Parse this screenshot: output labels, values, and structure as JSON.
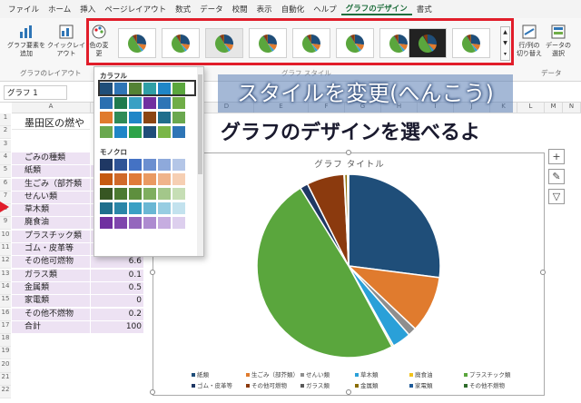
{
  "menu": [
    "ファイル",
    "ホーム",
    "挿入",
    "ページレイアウト",
    "数式",
    "データ",
    "校閲",
    "表示",
    "自動化",
    "ヘルプ",
    "グラフのデザイン",
    "書式"
  ],
  "ribbon": {
    "add_element": "グラフ要素を追加",
    "quick_layout": "クイックレイアウト",
    "change_colors": "色の変更",
    "layout_group": "グラフのレイアウト",
    "styles_group": "グラフ スタイル",
    "switch_rowcol": "行/列の切り替え",
    "select_data": "データの選択",
    "data_group": "データ"
  },
  "palette": {
    "colorful": "カラフル",
    "mono": "モノクロ",
    "colorful_rows": [
      [
        "#1f4e79",
        "#2e75b6",
        "#548235",
        "#2f9fa6",
        "#1f86c7",
        "#5aa63d"
      ],
      [
        "#2b6fb0",
        "#1f7a4e",
        "#39a0c4",
        "#7030a0",
        "#2e75b6",
        "#70ad47"
      ],
      [
        "#e07b2e",
        "#2e8b57",
        "#1f86c7",
        "#8b4513",
        "#1f6e8c",
        "#6aa84f"
      ],
      [
        "#6aa84f",
        "#1f86c7",
        "#2ea34a",
        "#1f4e79",
        "#7ab648",
        "#2e75b6"
      ]
    ],
    "mono_rows": [
      [
        "#1f3864",
        "#2f5496",
        "#4472c4",
        "#6b8fd0",
        "#8ea9db",
        "#b4c6e7"
      ],
      [
        "#c55a11",
        "#d06a2a",
        "#e07b39",
        "#ea9a62",
        "#f0b48b",
        "#f6cfb3"
      ],
      [
        "#375623",
        "#4c7a31",
        "#5e8f3e",
        "#7fae5f",
        "#a3c78a",
        "#c6deb5"
      ],
      [
        "#1f6e8c",
        "#2a86a8",
        "#3aa0c4",
        "#6ab7d4",
        "#97cde2",
        "#c3e2ee"
      ],
      [
        "#7030a0",
        "#7f46ad",
        "#9467bd",
        "#ad8bd0",
        "#c6ade0",
        "#ddcfee"
      ]
    ]
  },
  "formula": {
    "namebox": "グラフ 1"
  },
  "columns": [
    "A",
    "B",
    "C",
    "D",
    "E",
    "F",
    "G",
    "H",
    "I",
    "J",
    "K",
    "L",
    "M",
    "N"
  ],
  "sheet": {
    "title": "墨田区の燃や",
    "header": "ごみの種類",
    "rows": [
      [
        "紙類",
        ""
      ],
      [
        "生ごみ（部芥類",
        ""
      ],
      [
        "せんい類",
        ""
      ],
      [
        "草木類",
        ""
      ],
      [
        "廃食油",
        ""
      ],
      [
        "プラスチック類",
        ""
      ],
      [
        "ゴム・皮革等",
        "1.4"
      ],
      [
        "その他可燃物",
        "6.6"
      ],
      [
        "ガラス類",
        "0.1"
      ],
      [
        "金属類",
        "0.5"
      ],
      [
        "家電類",
        "0"
      ],
      [
        "その他不燃物",
        "0.2"
      ],
      [
        "合計",
        "100"
      ]
    ]
  },
  "chart_data": {
    "type": "pie",
    "title": "グラフ タイトル",
    "categories": [
      "紙類",
      "生ごみ（部芥類）",
      "せんい類",
      "草木類",
      "廃食油",
      "プラスチック類",
      "ゴム・皮革等",
      "その他可燃物",
      "ガラス類",
      "金属類",
      "家電類",
      "その他不燃物"
    ],
    "values": [
      27.0,
      10.0,
      1.5,
      3.3,
      0.3,
      49.0,
      1.4,
      6.6,
      0.1,
      0.5,
      0,
      0.2
    ],
    "colors": [
      "#1f4e79",
      "#e07b2e",
      "#8e8e8e",
      "#2aa0d8",
      "#f2c21b",
      "#5aa63d",
      "#1f3864",
      "#8b3a0e",
      "#595959",
      "#8a6d00",
      "#1f5b99",
      "#2e6b2a"
    ],
    "legend_position": "bottom"
  },
  "banners": {
    "top": "スタイルを変更(へんこう)",
    "bottom": "グラフのデザインを選べるよ"
  },
  "chart_tools": {
    "add": "+",
    "style": "✎",
    "filter": "▽"
  }
}
